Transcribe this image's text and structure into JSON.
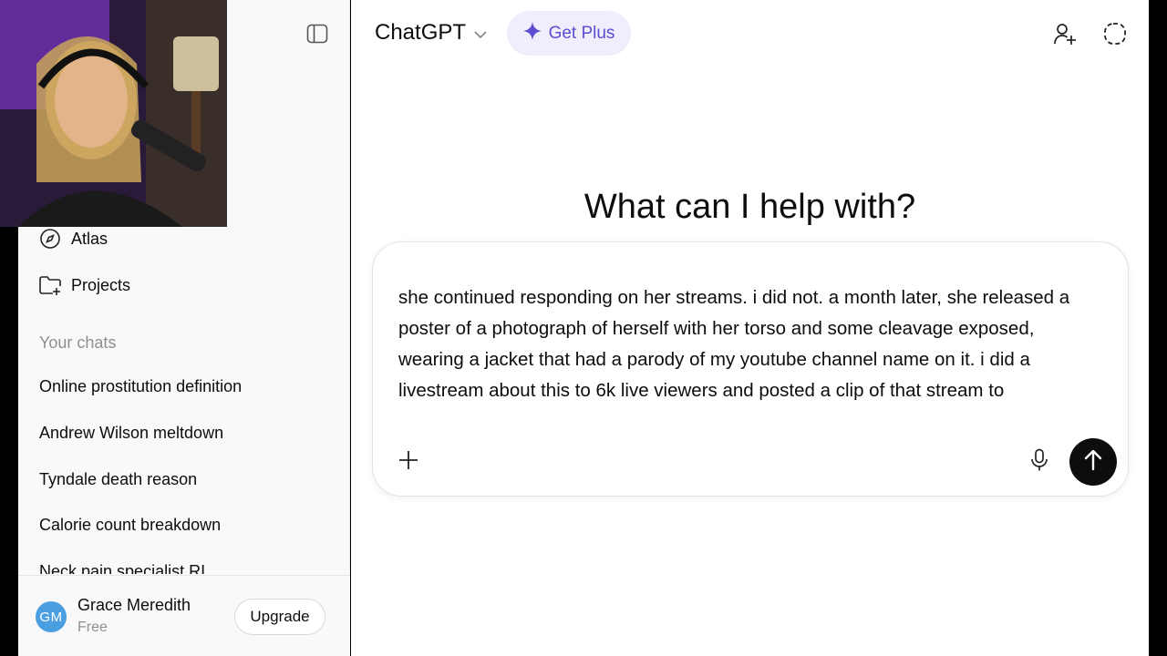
{
  "sidebar": {
    "nav": [
      {
        "label": "Atlas",
        "icon": "compass-icon"
      },
      {
        "label": "Projects",
        "icon": "folder-plus-icon"
      }
    ],
    "section_label": "Your chats",
    "chats": [
      "Online prostitution definition",
      "Andrew Wilson meltdown",
      "Tyndale death reason",
      "Calorie count breakdown",
      "Neck pain specialist RI"
    ],
    "user": {
      "initials": "GM",
      "name": "Grace Meredith",
      "plan": "Free",
      "upgrade_label": "Upgrade"
    }
  },
  "header": {
    "model": "ChatGPT",
    "get_plus": "Get Plus"
  },
  "hero": "What can I help with?",
  "composer": {
    "text": "she continued responding on her streams. i did not. a month later, she released a poster of a photograph of herself with her torso and some cleavage exposed, wearing a jacket that had a parody of my youtube channel name on it. i did a livestream about this to 6k live viewers and posted a clip of that stream to"
  },
  "colors": {
    "accent": "#5b4fcf",
    "avatar": "#4a9fe0",
    "send": "#0d0d0d"
  }
}
